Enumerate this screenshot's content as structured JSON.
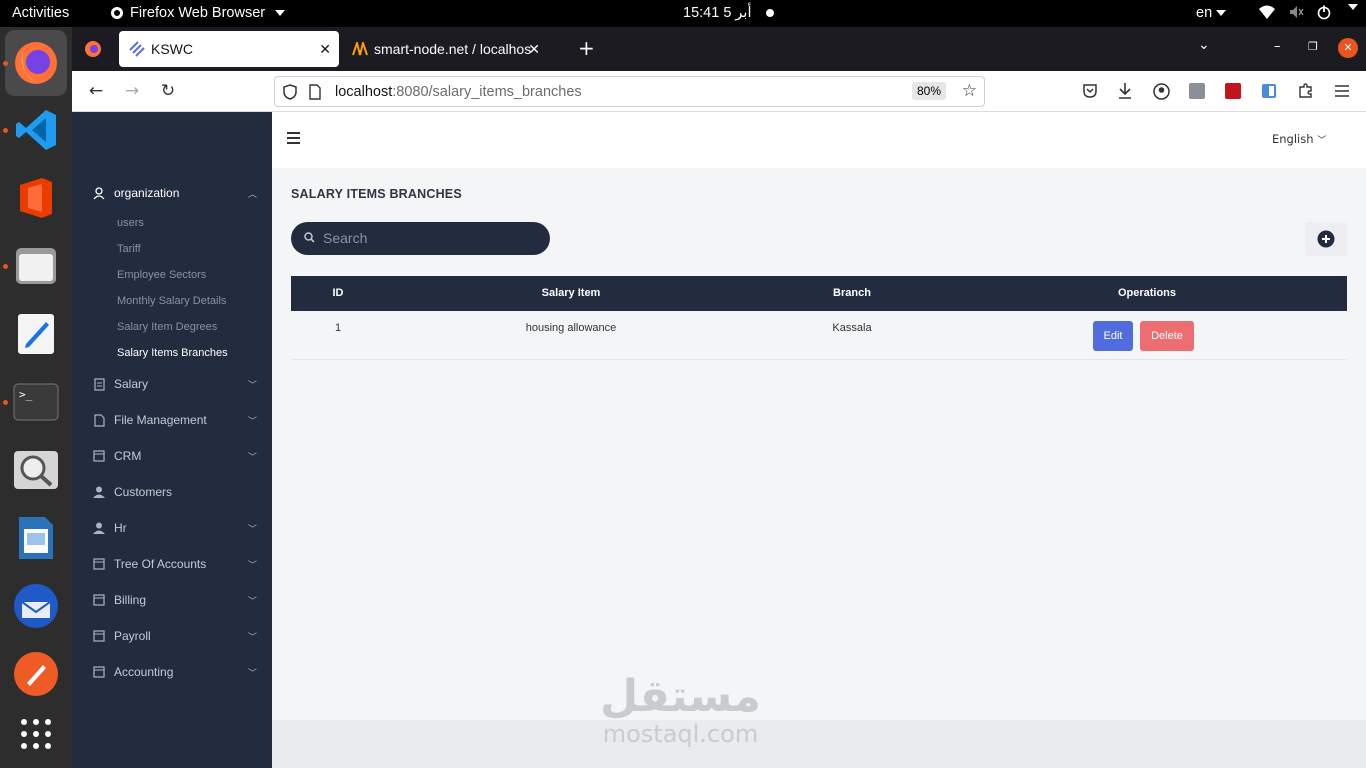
{
  "system_bar": {
    "activities": "Activities",
    "app_name": "Firefox Web Browser",
    "clock": "15:41  أبر 5",
    "lang": "en"
  },
  "browser": {
    "tabs": [
      {
        "title": "KSWC"
      },
      {
        "title": "smart-node.net / localhos"
      }
    ],
    "url_host": "localhost",
    "url_path": ":8080/salary_items_branches",
    "zoom": "80%"
  },
  "sidebar": {
    "organization": "organization",
    "sub_items": [
      "users",
      "Tariff",
      "Employee Sectors",
      "Monthly Salary Details",
      "Salary Item Degrees",
      "Salary Items Branches"
    ],
    "items": [
      "Salary",
      "File Management",
      "CRM",
      "Customers",
      "Hr",
      "Tree Of Accounts",
      "Billing",
      "Payroll",
      "Accounting"
    ]
  },
  "header": {
    "language": "English"
  },
  "page": {
    "title": "SALARY ITEMS BRANCHES",
    "search_placeholder": "Search"
  },
  "table": {
    "columns": [
      "ID",
      "Salary Item",
      "Branch",
      "Operations"
    ],
    "rows": [
      {
        "id": "1",
        "salary_item": "housing allowance",
        "branch": "Kassala",
        "edit": "Edit",
        "delete": "Delete"
      }
    ]
  },
  "watermark": {
    "arabic": "مستقل",
    "latin": "mostaql.com"
  },
  "colors": {
    "sidebar_bg": "#232b3e",
    "edit_button": "#4f6ddf",
    "delete_button": "#ec6e72",
    "dock_bg": "#2d2d2d"
  }
}
